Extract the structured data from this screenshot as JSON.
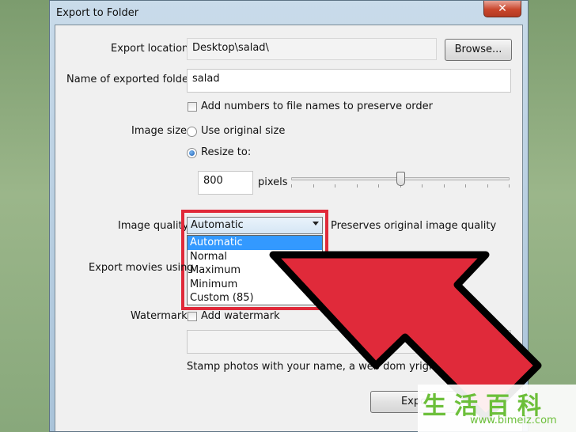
{
  "window": {
    "title": "Export to Folder",
    "close_glyph": "✕"
  },
  "export_location": {
    "label": "Export location:",
    "value": "Desktop\\salad\\",
    "browse_label": "Browse..."
  },
  "folder_name": {
    "label": "Name of exported folder:",
    "value": "salad"
  },
  "add_numbers": {
    "label": "Add numbers to file names to preserve order",
    "checked": false
  },
  "image_size": {
    "label": "Image size:",
    "option_original": "Use original size",
    "option_resize": "Resize to:",
    "selected": "resize",
    "pixels_value": "800",
    "pixels_unit": "pixels",
    "slider_fraction": 0.5
  },
  "image_quality": {
    "label": "Image quality",
    "selected": "Automatic",
    "description": "Preserves original image quality",
    "options": [
      "Automatic",
      "Normal",
      "Maximum",
      "Minimum",
      "Custom (85)"
    ]
  },
  "export_movies": {
    "label": "Export movies using"
  },
  "watermark": {
    "label": "Watermark:",
    "checkbox_label": "Add watermark",
    "help_text": "Stamp photos with your name, a web dom      yright noti"
  },
  "footer": {
    "export_label": "Expo"
  },
  "colors": {
    "highlight": "#e02a3a",
    "selection": "#3399ff",
    "logo_green": "#6cbf3a"
  },
  "logo": {
    "chars": "生活百科",
    "url": "www.bimeiz.com"
  }
}
